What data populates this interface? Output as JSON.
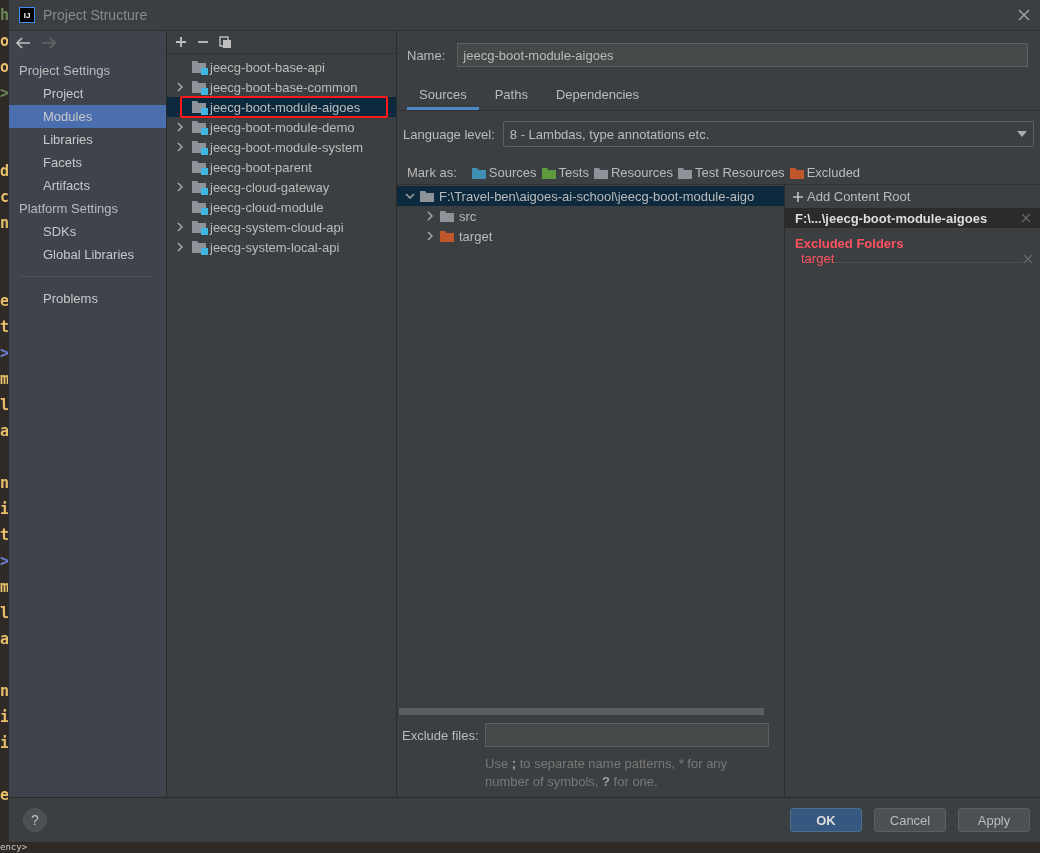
{
  "editor_lines": [
    {
      "text": "h",
      "color": "#6a8759"
    },
    {
      "text": "o",
      "color": "#e8bf6a"
    },
    {
      "text": "o",
      "color": "#e8bf6a"
    },
    {
      "text": ">",
      "color": "#6a8759"
    },
    {
      "text": "d",
      "color": "#e8bf6a"
    },
    {
      "text": "c",
      "color": "#e8bf6a"
    },
    {
      "text": "n",
      "color": "#e8bf6a"
    },
    {
      "text": "e",
      "color": "#e8bf6a"
    },
    {
      "text": "t",
      "color": "#e8bf6a"
    },
    {
      "text": ">",
      "color": "#6d7fd8"
    },
    {
      "text": "m",
      "color": "#e8bf6a"
    },
    {
      "text": "l",
      "color": "#e8bf6a"
    },
    {
      "text": "a",
      "color": "#e8bf6a"
    },
    {
      "text": "n",
      "color": "#e8bf6a"
    },
    {
      "text": "i",
      "color": "#e8bf6a"
    },
    {
      "text": "t",
      "color": "#e8bf6a"
    },
    {
      "text": ">",
      "color": "#6d7fd8"
    },
    {
      "text": "m",
      "color": "#e8bf6a"
    },
    {
      "text": "l",
      "color": "#e8bf6a"
    },
    {
      "text": "a",
      "color": "#e8bf6a"
    },
    {
      "text": "n",
      "color": "#e8bf6a"
    },
    {
      "text": "i",
      "color": "#e8bf6a"
    },
    {
      "text": "i",
      "color": "#e8bf6a"
    },
    {
      "text": "e",
      "color": "#e8bf6a"
    }
  ],
  "editor_bottom": "ency>",
  "window": {
    "title": "Project Structure",
    "logo": "IJ"
  },
  "sidebar": {
    "sections": [
      {
        "title": "Project Settings",
        "items": [
          {
            "label": "Project",
            "selected": false
          },
          {
            "label": "Modules",
            "selected": true
          },
          {
            "label": "Libraries",
            "selected": false
          },
          {
            "label": "Facets",
            "selected": false
          },
          {
            "label": "Artifacts",
            "selected": false
          }
        ]
      },
      {
        "title": "Platform Settings",
        "items": [
          {
            "label": "SDKs",
            "selected": false
          },
          {
            "label": "Global Libraries",
            "selected": false
          }
        ]
      }
    ],
    "footer_items": [
      {
        "label": "Problems",
        "selected": false
      }
    ]
  },
  "modules": [
    {
      "name": "jeecg-boot-base-api",
      "expandable": false,
      "selected": false,
      "annotated": false
    },
    {
      "name": "jeecg-boot-base-common",
      "expandable": true,
      "selected": false,
      "annotated": false
    },
    {
      "name": "jeecg-boot-module-aigoes",
      "expandable": false,
      "selected": true,
      "annotated": true
    },
    {
      "name": "jeecg-boot-module-demo",
      "expandable": true,
      "selected": false,
      "annotated": false
    },
    {
      "name": "jeecg-boot-module-system",
      "expandable": true,
      "selected": false,
      "annotated": false
    },
    {
      "name": "jeecg-boot-parent",
      "expandable": false,
      "selected": false,
      "annotated": false
    },
    {
      "name": "jeecg-cloud-gateway",
      "expandable": true,
      "selected": false,
      "annotated": false
    },
    {
      "name": "jeecg-cloud-module",
      "expandable": false,
      "selected": false,
      "annotated": false
    },
    {
      "name": "jeecg-system-cloud-api",
      "expandable": true,
      "selected": false,
      "annotated": false
    },
    {
      "name": "jeecg-system-local-api",
      "expandable": true,
      "selected": false,
      "annotated": false
    }
  ],
  "detail": {
    "name_label": "Name:",
    "name_value": "jeecg-boot-module-aigoes",
    "tabs": [
      {
        "label": "Sources",
        "selected": true
      },
      {
        "label": "Paths",
        "selected": false
      },
      {
        "label": "Dependencies",
        "selected": false
      }
    ],
    "language_label": "Language level:",
    "language_value": "8 - Lambdas, type annotations etc.",
    "mark_label": "Mark as:",
    "mark_buttons": [
      {
        "label": "Sources",
        "color": "#3f8fb5"
      },
      {
        "label": "Tests",
        "color": "#5f9a3f"
      },
      {
        "label": "Resources",
        "color": "#8d9399"
      },
      {
        "label": "Test Resources",
        "color": "#8d9399"
      },
      {
        "label": "Excluded",
        "color": "#c0562b"
      }
    ],
    "tree": {
      "label": "F:\\Travel-ben\\aigoes-ai-school\\jeecg-boot-module-aigo",
      "expanded": true,
      "selected": true,
      "color": "#8d9399",
      "children": [
        {
          "label": "src",
          "expanded": false,
          "selected": false,
          "color": "#8d9399"
        },
        {
          "label": "target",
          "expanded": false,
          "selected": false,
          "color": "#c0562b"
        }
      ]
    },
    "exclude_label": "Exclude files:",
    "exclude_hint": "Use **;** to separate name patterns, * for any number of symbols, **?** for one.",
    "content_root": {
      "add_label": "Add Content Root",
      "root": "F:\\...\\jeecg-boot-module-aigoes",
      "excluded_title": "Excluded Folders",
      "excluded": [
        "target"
      ]
    }
  },
  "buttons": [
    {
      "label": "OK",
      "kind": "primary"
    },
    {
      "label": "Cancel",
      "kind": "default"
    },
    {
      "label": "Apply",
      "kind": "default"
    }
  ],
  "help": "?"
}
